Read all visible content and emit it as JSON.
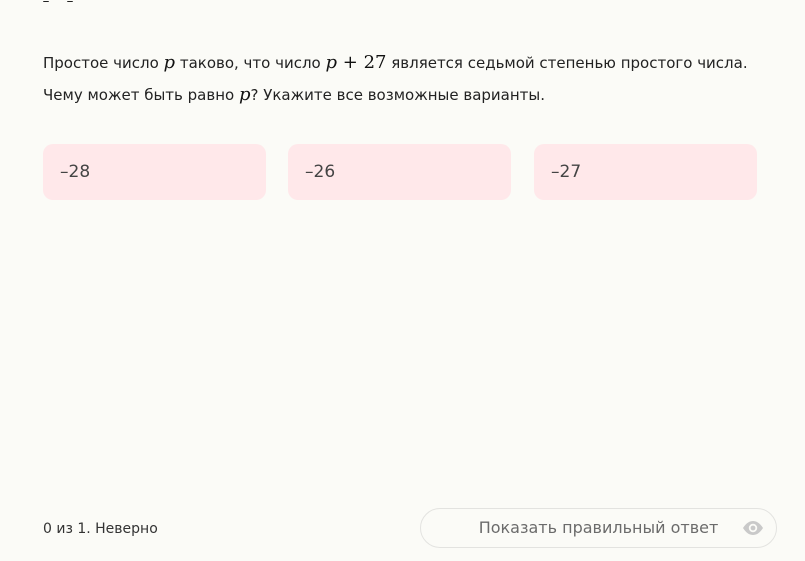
{
  "question": {
    "part1": "Простое число ",
    "var_p": "p",
    "part2": " таково, что число ",
    "expr_p": "p",
    "expr_plus": " + ",
    "expr_num": "27",
    "part3": " является седьмой степенью простого числа. Чему может быть равно ",
    "var_p2": "p",
    "part4": "? Укажите все возможные варианты."
  },
  "options": [
    {
      "label": "–28"
    },
    {
      "label": "–26"
    },
    {
      "label": "–27"
    }
  ],
  "footer": {
    "status": "0 из 1. Неверно",
    "show_answer_label": "Показать правильный ответ",
    "icon": "eye-icon"
  },
  "colors": {
    "background": "#fbfbf7",
    "option_background": "#ffe8ea",
    "text": "#222222",
    "muted": "#6b6b6b"
  }
}
